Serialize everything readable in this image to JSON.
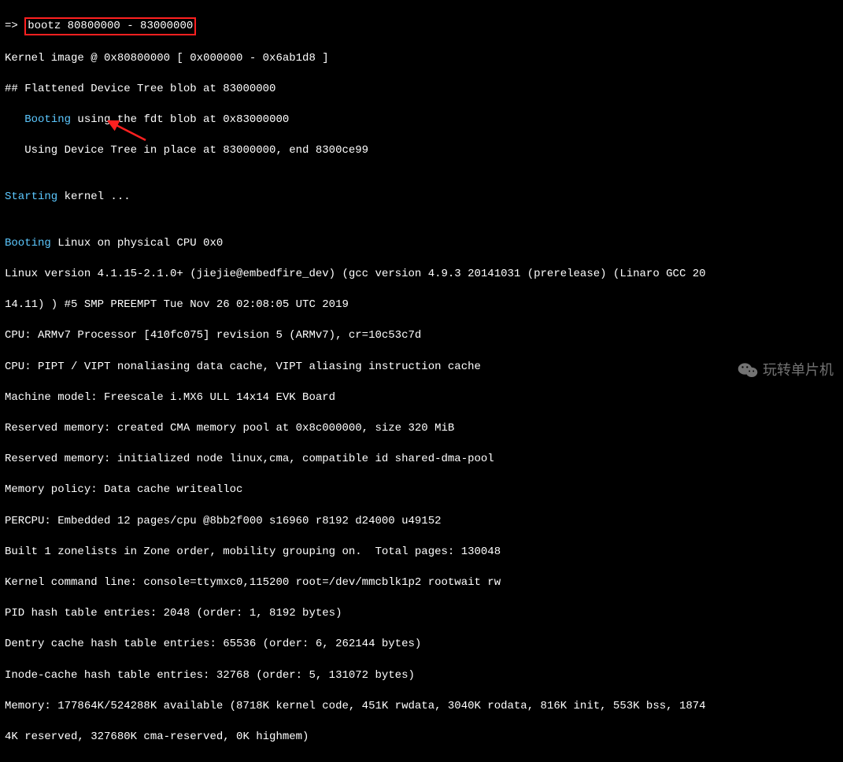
{
  "prompt": {
    "arrow": "=> ",
    "command": "bootz 80800000 - 83000000"
  },
  "lines": [
    "Kernel image @ 0x80800000 [ 0x000000 - 0x6ab1d8 ]",
    "## Flattened Device Tree blob at 83000000"
  ],
  "booting_fdt": {
    "prefix": "   ",
    "keyword": "Booting",
    "rest": " using the fdt blob at 0x83000000"
  },
  "lines2": [
    "   Using Device Tree in place at 83000000, end 8300ce99",
    ""
  ],
  "starting_kernel": {
    "keyword": "Starting",
    "rest": " kernel ..."
  },
  "blank": "",
  "booting_linux": {
    "keyword": "Booting",
    "rest": " Linux on physical CPU 0x0"
  },
  "bootlog": [
    "Linux version 4.1.15-2.1.0+ (jiejie@embedfire_dev) (gcc version 4.9.3 20141031 (prerelease) (Linaro GCC 20",
    "14.11) ) #5 SMP PREEMPT Tue Nov 26 02:08:05 UTC 2019",
    "CPU: ARMv7 Processor [410fc075] revision 5 (ARMv7), cr=10c53c7d",
    "CPU: PIPT / VIPT nonaliasing data cache, VIPT aliasing instruction cache",
    "Machine model: Freescale i.MX6 ULL 14x14 EVK Board",
    "Reserved memory: created CMA memory pool at 0x8c000000, size 320 MiB",
    "Reserved memory: initialized node linux,cma, compatible id shared-dma-pool",
    "Memory policy: Data cache writealloc",
    "PERCPU: Embedded 12 pages/cpu @8bb2f000 s16960 r8192 d24000 u49152",
    "Built 1 zonelists in Zone order, mobility grouping on.  Total pages: 130048",
    "Kernel command line: console=ttymxc0,115200 root=/dev/mmcblk1p2 rootwait rw",
    "PID hash table entries: 2048 (order: 1, 8192 bytes)",
    "Dentry cache hash table entries: 65536 (order: 6, 262144 bytes)",
    "Inode-cache hash table entries: 32768 (order: 5, 131072 bytes)",
    "Memory: 177864K/524288K available (8718K kernel code, 451K rwdata, 3040K rodata, 816K init, 553K bss, 1874",
    "4K reserved, 327680K cma-reserved, 0K highmem)"
  ],
  "watermark": {
    "text": "玩转单片机"
  }
}
